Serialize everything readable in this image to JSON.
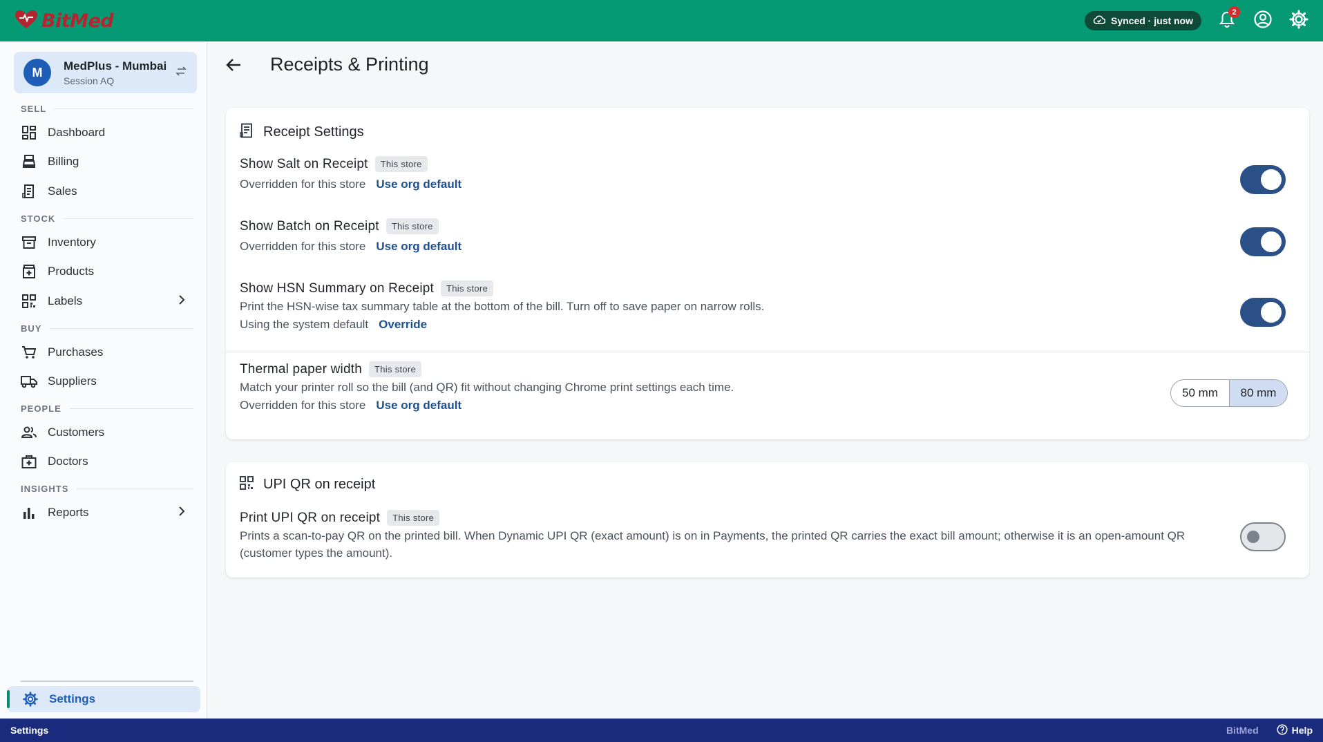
{
  "app": {
    "brand": "BitMed",
    "sync_status": "Synced · just now",
    "notification_count": "2"
  },
  "sidebar": {
    "store": {
      "avatar": "M",
      "name": "MedPlus - Mumbai",
      "session": "Session AQ"
    },
    "sections": {
      "sell": "SELL",
      "stock": "STOCK",
      "buy": "BUY",
      "people": "PEOPLE",
      "insights": "INSIGHTS"
    },
    "items": {
      "dashboard": "Dashboard",
      "billing": "Billing",
      "sales": "Sales",
      "inventory": "Inventory",
      "products": "Products",
      "labels": "Labels",
      "purchases": "Purchases",
      "suppliers": "Suppliers",
      "customers": "Customers",
      "doctors": "Doctors",
      "reports": "Reports",
      "settings": "Settings"
    }
  },
  "page": {
    "title": "Receipts & Printing"
  },
  "receipt_settings": {
    "title": "Receipt Settings",
    "items": [
      {
        "title": "Show Salt on Receipt",
        "scope": "This store",
        "status": "Overridden for this store",
        "action": "Use org default",
        "enabled": true
      },
      {
        "title": "Show Batch on Receipt",
        "scope": "This store",
        "status": "Overridden for this store",
        "action": "Use org default",
        "enabled": true
      },
      {
        "title": "Show HSN Summary on Receipt",
        "scope": "This store",
        "description": "Print the HSN-wise tax summary table at the bottom of the bill. Turn off to save paper on narrow rolls.",
        "status": "Using the system default",
        "action": "Override",
        "enabled": true
      }
    ],
    "paper_width": {
      "title": "Thermal paper width",
      "scope": "This store",
      "description": "Match your printer roll so the bill (and QR) fit without changing Chrome print settings each time.",
      "status": "Overridden for this store",
      "action": "Use org default",
      "options": [
        "50 mm",
        "80 mm"
      ],
      "selected": "80 mm"
    }
  },
  "upi_qr": {
    "title": "UPI QR on receipt",
    "item": {
      "title": "Print UPI QR on receipt",
      "scope": "This store",
      "description": "Prints a scan-to-pay QR on the printed bill. When Dynamic UPI QR (exact amount) is on in Payments, the printed QR carries the exact bill amount; otherwise it is an open-amount QR (customer types the amount).",
      "enabled": false
    }
  },
  "statusbar": {
    "crumb": "Settings",
    "brand": "BitMed",
    "help": "Help"
  },
  "colors": {
    "topbar": "#069a74",
    "accent_blue": "#2b5088",
    "statusbar": "#1a2a7d",
    "brand_red": "#b3262f"
  }
}
